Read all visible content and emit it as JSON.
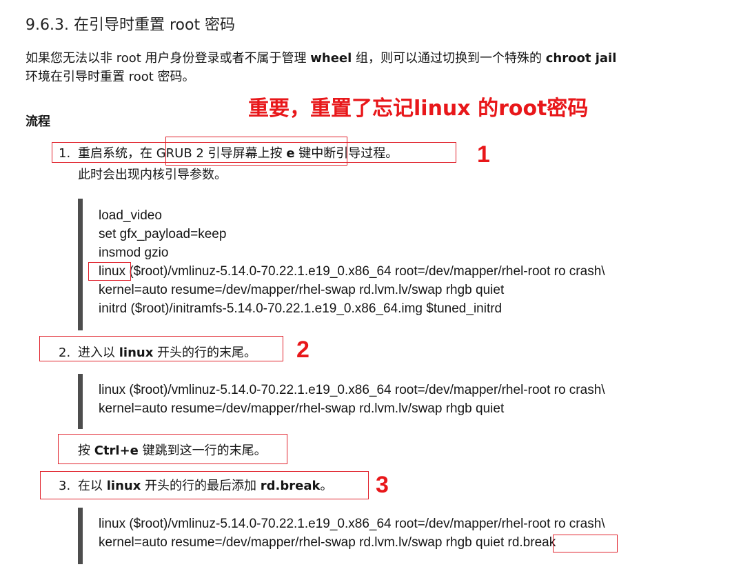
{
  "section": {
    "heading": "9.6.3. 在引导时重置 root 密码",
    "intro_line1_pre": "如果您无法以非 root 用户身份登录或者不属于管理 ",
    "intro_line1_bold1": "wheel",
    "intro_line1_mid": " 组，则可以通过切换到一个特殊的 ",
    "intro_line1_bold2": "chroot jail",
    "intro_line2": "环境在引导时重置 root 密码。",
    "annotation": "重要，重置了忘记linux 的root密码",
    "procedure_title": "流程"
  },
  "steps": [
    {
      "number": "1.",
      "text_pre": "重启系统，在 GRUB 2 引导屏幕上按 ",
      "bold": "e",
      "text_post": " 键中断引导过程。",
      "subtext": "此时会出现内核引导参数。",
      "marker": "1",
      "code": [
        "load_video",
        "set gfx_payload=keep",
        "insmod gzio",
        "linux ($root)/vmlinuz-5.14.0-70.22.1.e19_0.x86_64 root=/dev/mapper/rhel-root ro crash\\",
        "kernel=auto resume=/dev/mapper/rhel-swap rd.lvm.lv/swap rhgb quiet",
        "initrd ($root)/initramfs-5.14.0-70.22.1.e19_0.x86_64.img $tuned_initrd"
      ]
    },
    {
      "number": "2.",
      "text_pre": "进入以 ",
      "bold": "linux",
      "text_post": " 开头的行的末尾。",
      "marker": "2",
      "code": [
        "linux ($root)/vmlinuz-5.14.0-70.22.1.e19_0.x86_64 root=/dev/mapper/rhel-root ro crash\\",
        "kernel=auto resume=/dev/mapper/rhel-swap rd.lvm.lv/swap rhgb quiet"
      ],
      "note_pre": "按 ",
      "note_bold": "Ctrl+e",
      "note_post": " 键跳到这一行的末尾。"
    },
    {
      "number": "3.",
      "text_pre": "在以 ",
      "bold": "linux",
      "text_mid": " 开头的行的最后添加 ",
      "bold2": "rd.break",
      "text_post": "。",
      "marker": "3",
      "code": [
        "linux ($root)/vmlinuz-5.14.0-70.22.1.e19_0.x86_64 root=/dev/mapper/rhel-root ro crash\\",
        "kernel=auto resume=/dev/mapper/rhel-swap rd.lvm.lv/swap rhgb quiet rd.break"
      ]
    }
  ],
  "colors": {
    "annotation": "#e8171a",
    "code_bar": "#4d4d4d",
    "text": "#151515"
  }
}
